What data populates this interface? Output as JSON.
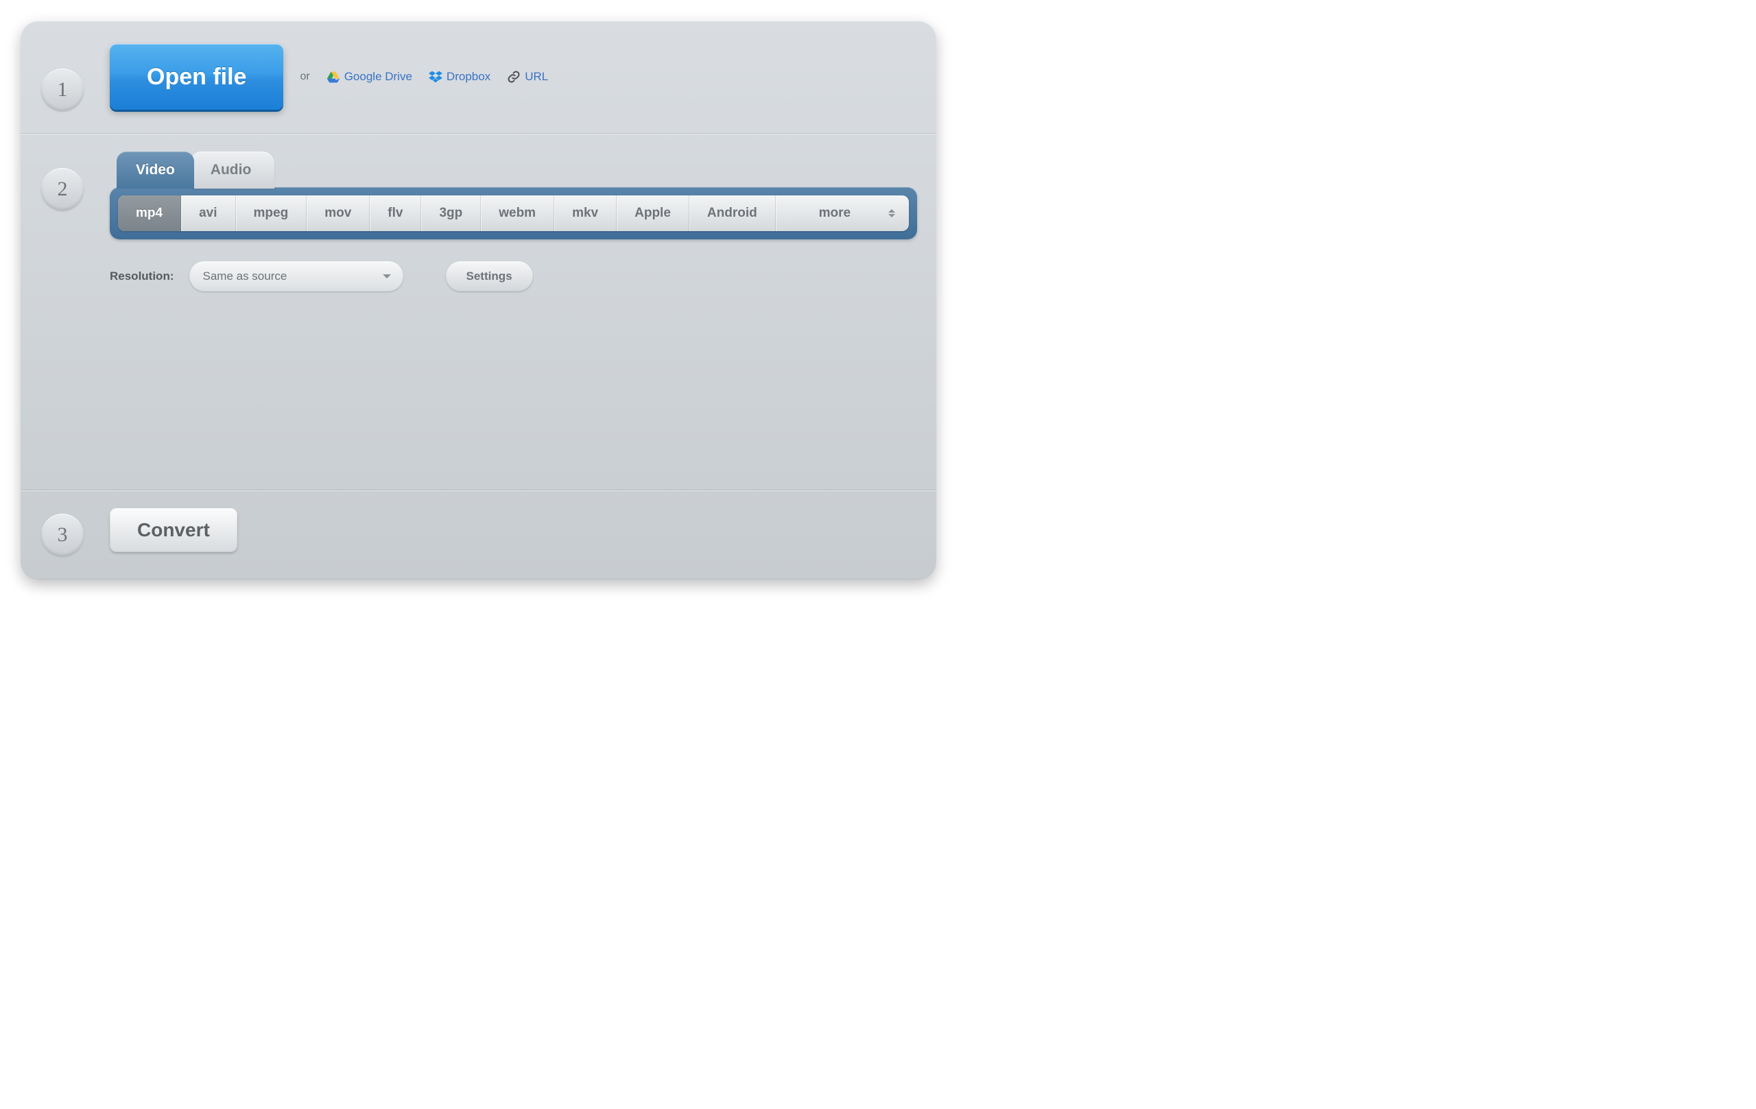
{
  "steps": {
    "one": "1",
    "two": "2",
    "three": "3"
  },
  "open": {
    "button_label": "Open file",
    "or_text": "or",
    "google_drive_label": "Google Drive",
    "dropbox_label": "Dropbox",
    "url_label": "URL"
  },
  "tabs": {
    "video_label": "Video",
    "audio_label": "Audio"
  },
  "formats": {
    "items": [
      "mp4",
      "avi",
      "mpeg",
      "mov",
      "flv",
      "3gp",
      "webm",
      "mkv",
      "Apple",
      "Android"
    ],
    "more_label": "more",
    "selected": "mp4"
  },
  "resolution": {
    "label": "Resolution:",
    "value": "Same as source"
  },
  "settings_label": "Settings",
  "convert_label": "Convert"
}
